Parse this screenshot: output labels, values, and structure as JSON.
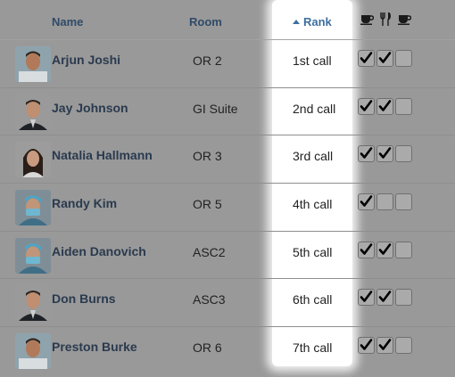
{
  "header": {
    "name_label": "Name",
    "room_label": "Room",
    "rank_label": "Rank",
    "icons": [
      "coffee-icon",
      "fork-knife-icon",
      "coffee-icon"
    ]
  },
  "rows": [
    {
      "name": "Arjun Joshi",
      "room": "OR 2",
      "rank": "1st call",
      "checks": [
        true,
        true,
        false
      ],
      "avatar": "doctor-avatar"
    },
    {
      "name": "Jay Johnson",
      "room": "GI Suite",
      "rank": "2nd call",
      "checks": [
        true,
        true,
        false
      ],
      "avatar": "suit-avatar"
    },
    {
      "name": "Natalia Hallmann",
      "room": "OR 3",
      "rank": "3rd call",
      "checks": [
        true,
        true,
        false
      ],
      "avatar": "woman-avatar"
    },
    {
      "name": "Randy Kim",
      "room": "OR 5",
      "rank": "4th call",
      "checks": [
        true,
        false,
        false
      ],
      "avatar": "surgeon-avatar"
    },
    {
      "name": "Aiden Danovich",
      "room": "ASC2",
      "rank": "5th call",
      "checks": [
        true,
        true,
        false
      ],
      "avatar": "surgeon-avatar"
    },
    {
      "name": "Don Burns",
      "room": "ASC3",
      "rank": "6th call",
      "checks": [
        true,
        true,
        false
      ],
      "avatar": "suit-avatar"
    },
    {
      "name": "Preston Burke",
      "room": "OR 6",
      "rank": "7th call",
      "checks": [
        true,
        true,
        false
      ],
      "avatar": "doctor-avatar"
    }
  ],
  "colors": {
    "overlay": "#999999",
    "highlight": "#ffffff",
    "header_text": "#2f4a68",
    "sort_accent": "#3d6e9e"
  }
}
